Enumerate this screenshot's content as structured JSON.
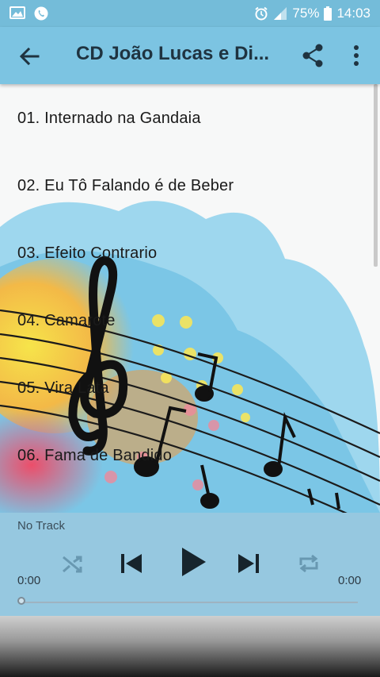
{
  "status_bar": {
    "battery": "75%",
    "time": "14:03",
    "icons": [
      "image-icon",
      "whatsapp-icon",
      "alarm-icon",
      "signal-icon",
      "battery-icon"
    ]
  },
  "app_bar": {
    "title": "CD João Lucas e Di...",
    "icons": [
      "back-arrow-icon",
      "share-icon",
      "more-vert-icon"
    ]
  },
  "tracks": [
    "01. Internado na Gandaia",
    "02. Eu Tô Falando é de Beber",
    "03. Efeito Contrario",
    "04. Camarote",
    "05. Vira Lata",
    "06. Fama de Bandido"
  ],
  "player": {
    "status": "No Track",
    "elapsed": "0:00",
    "duration": "0:00",
    "progress": 0,
    "controls": [
      "shuffle-icon",
      "previous-icon",
      "play-icon",
      "next-icon",
      "repeat-icon"
    ]
  },
  "colors": {
    "app_bar": "#7cc4e2",
    "status_bar": "#74bcd9",
    "player_bg": "#78b9d7"
  }
}
